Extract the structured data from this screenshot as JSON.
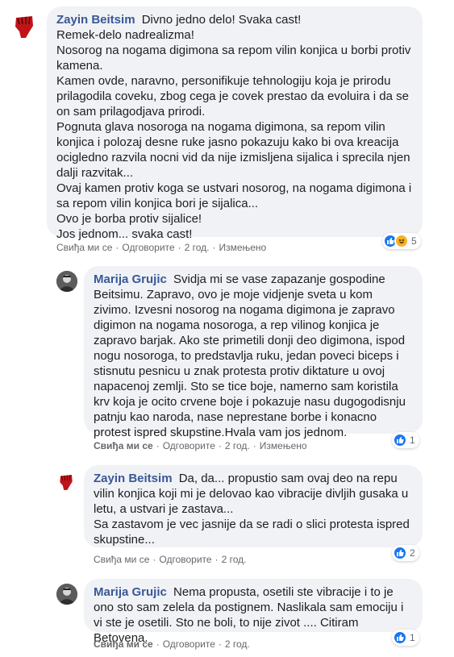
{
  "colors": {
    "author": "#385898",
    "bubble": "#f0f2f5",
    "meta": "#65676b",
    "like_blue": "#1877f2",
    "haha_yellow": "#f7b125"
  },
  "comments": [
    {
      "author": "Zayin Beitsim",
      "text": "Divno jedno delo! Svaka cast!\nRemek-delo nadrealizma!\nNosorog na nogama digimona sa repom vilin konjica u borbi protiv kamena.\nKamen ovde, naravno, personifikuje tehnologiju koja je prirodu prilagodila coveku, zbog cega je covek prestao da evoluira i da se on sam prilagodjava prirodi.\nPognuta glava nosoroga na nogama digimona, sa repom vilin konjica i polozaj desne ruke jasno pokazuju kako bi ova kreacija ocigledno razvila nocni vid da nije izmisljena sijalica i sprecila njen dalji razvitak...\nOvaj kamen protiv koga se ustvari nosorog, na nogama digimona i sa repom vilin konjica bori je sijalica...\nOvo je borba protiv sijalice!\nJos jednom... svaka cast!",
      "like_label": "Свиђа ми се",
      "reply_label": "Одговорите",
      "time": "2 год.",
      "edited_label": "Измењено",
      "reaction_icons": [
        "like-icon",
        "haha-icon"
      ],
      "reaction_count": "5"
    },
    {
      "author": "Marija Grujic",
      "text": "Svidja mi se vase zapazanje gospodine Beitsimu. Zapravo, ovo je moje vidjenje sveta u kom zivimo. Izvesni nosorog na nogama digimona je zapravo digimon na nogama nosoroga, a rep vilinog konjica je zapravo barjak. Ako ste primetili donji deo digimona, ispod nogu nosoroga, to predstavlja ruku, jedan poveci biceps i stisnutu pesnicu u znak protesta protiv diktature u ovoj napacenoj zemlji. Sto se tice boje, namerno sam koristila krv koja je ocito crvene boje i pokazuje nasu dugogodisnju patnju kao naroda, nase neprestane borbe i konacno protest ispred skupstine.Hvala vam jos jednom.",
      "like_label": "Свиђа ми се",
      "reply_label": "Одговорите",
      "time": "2 год.",
      "edited_label": "Измењено",
      "reaction_icons": [
        "like-icon"
      ],
      "reaction_count": "1"
    },
    {
      "author": "Zayin Beitsim",
      "text": "Da, da... propustio sam ovaj deo na repu vilin konjica koji mi je delovao kao vibracije divljih gusaka u letu, a ustvari je zastava...\nSa zastavom je vec jasnije da se radi o slici protesta ispred skupstine...",
      "like_label": "Свиђа ми се",
      "reply_label": "Одговорите",
      "time": "2 год.",
      "reaction_icons": [
        "like-icon"
      ],
      "reaction_count": "2"
    },
    {
      "author": "Marija Grujic",
      "text": "Nema propusta, osetili ste vibracije i to je ono sto sam zelela da postignem. Naslikala sam emociju i vi ste je osetili. Sto ne boli, to nije zivot .... Citiram Betovena.",
      "like_label": "Свиђа ми се",
      "reply_label": "Одговорите",
      "time": "2 год.",
      "reaction_icons": [
        "like-icon"
      ],
      "reaction_count": "1"
    }
  ]
}
